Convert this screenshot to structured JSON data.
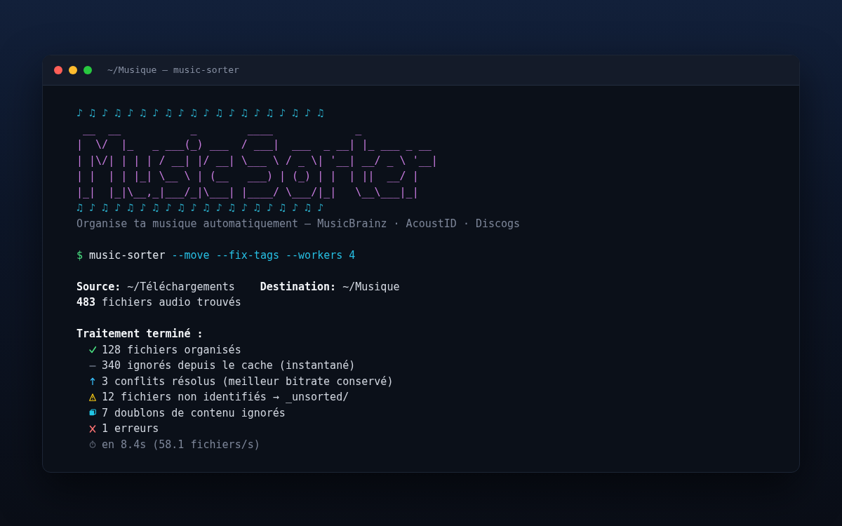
{
  "window": {
    "title": "~/Musique — music-sorter"
  },
  "banner": {
    "notes_top": "♪ ♫ ♪ ♫ ♪ ♫ ♪ ♫ ♪ ♫ ♪ ♫ ♪ ♫ ♪ ♫ ♪ ♫ ♪ ♫",
    "ascii_art": [
      " __  __           _        ____             _",
      "|  \\/  |_   _ ___(_) ___  / ___|  ___  _ __| |_ ___ _ __",
      "| |\\/| | | | / __| |/ __| \\___ \\ / _ \\| '__| __/ _ \\ '__|",
      "| |  | | |_| \\__ \\ | (__   ___) | (_) | |  | ||  __/ |",
      "|_|  |_|\\__,_|___/_|\\___| |____/ \\___/|_|   \\__\\___|_|"
    ],
    "notes_bottom": "♫ ♪ ♫ ♪ ♫ ♪ ♫ ♪ ♫ ♪ ♫ ♪ ♫ ♪ ♫ ♪ ♫ ♪ ♫ ♪",
    "tagline": "Organise ta musique automatiquement — MusicBrainz · AcoustID · Discogs"
  },
  "command": {
    "prompt": "$",
    "program": "music-sorter",
    "flags": "--move --fix-tags --workers 4"
  },
  "scan": {
    "source": "**Source:** ~/Téléchargements",
    "destination": "**Destination:** ~/Musique",
    "found": "**483** fichiers audio trouvés"
  },
  "summary": {
    "heading": "Traitement terminé :",
    "results": [
      {
        "kind": "success",
        "text": "128 fichiers organisés"
      },
      {
        "kind": "cached",
        "text": "340 ignorés depuis le cache (instantané)"
      },
      {
        "kind": "conflict",
        "text": "3 conflits résolus (meilleur bitrate conservé)"
      },
      {
        "kind": "warning",
        "text": "12 fichiers non identifiés → _unsorted/"
      },
      {
        "kind": "duplicate",
        "text": "7 doublons de contenu ignorés"
      },
      {
        "kind": "error",
        "text": "1 erreurs"
      },
      {
        "kind": "timing",
        "text": "en 8.4s (58.1 fichiers/s)"
      }
    ]
  }
}
